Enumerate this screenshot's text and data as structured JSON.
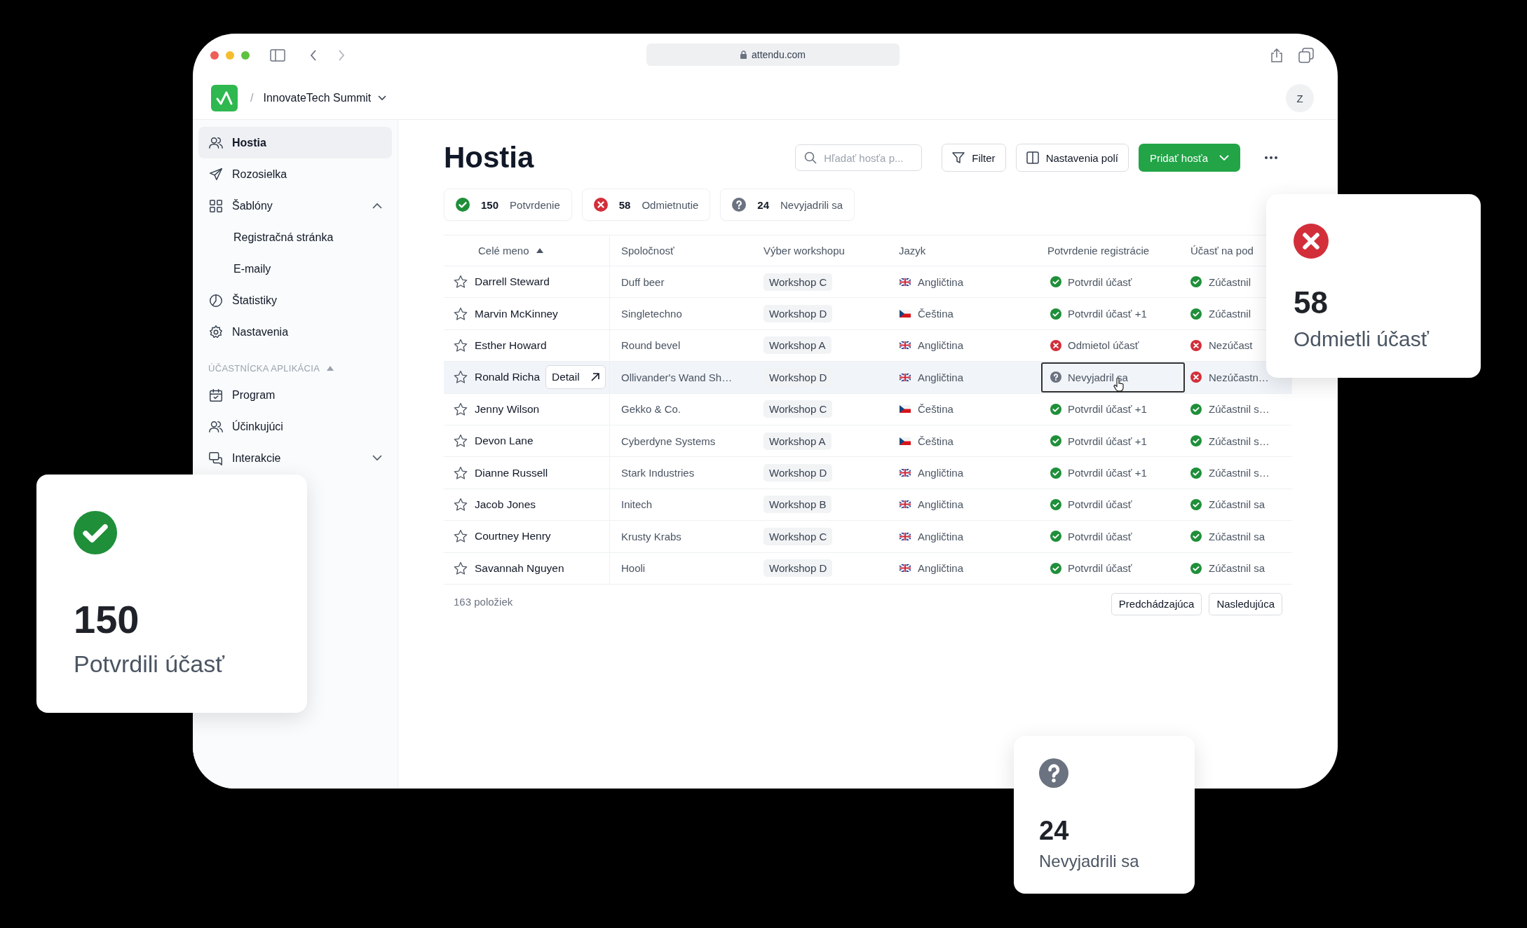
{
  "browser": {
    "url": "attendu.com"
  },
  "header": {
    "breadcrumb": "/",
    "event": "InnovateTech Summit",
    "avatar": "Z"
  },
  "sidebar": {
    "items": [
      {
        "kind": "people",
        "label": "Hostia",
        "selected": true
      },
      {
        "kind": "send",
        "label": "Rozosielka",
        "selected": false
      },
      {
        "kind": "grid",
        "label": "Šablóny",
        "selected": false,
        "expanded": true,
        "children": [
          {
            "label": "Registračná stránka",
            "selected": false
          },
          {
            "label": "E-maily",
            "selected": false
          }
        ]
      },
      {
        "kind": "chart",
        "label": "Štatistiky",
        "selected": false
      },
      {
        "kind": "gear",
        "label": "Nastavenia",
        "selected": false
      }
    ],
    "section": {
      "title": "ÚČASTNÍCKA APLIKÁCIA",
      "expanded": true
    },
    "section_items": [
      {
        "kind": "calendar",
        "label": "Program",
        "selected": false
      },
      {
        "kind": "people",
        "label": "Účinkujúci",
        "selected": false
      },
      {
        "kind": "chat",
        "label": "Interakcie",
        "selected": false,
        "expanded": false
      }
    ]
  },
  "page": {
    "title": "Hostia",
    "search": {
      "placeholder": "Hľadať hosťa p..."
    },
    "buttons": [
      "Filter",
      "Nastavenia polí"
    ],
    "primary_button": "Pridať hosťa"
  },
  "stats": [
    {
      "kind": "confirmed",
      "count": "150",
      "label": "Potvrdenie"
    },
    {
      "kind": "declined",
      "count": "58",
      "label": "Odmietnutie"
    },
    {
      "kind": "unknown",
      "count": "24",
      "label": "Nevyjadrili sa"
    }
  ],
  "table": {
    "columns": [
      {
        "label": "Celé meno",
        "sorted": true
      },
      {
        "label": "Spoločnosť",
        "sorted": false
      },
      {
        "label": "Výber workshopu",
        "sorted": false
      },
      {
        "label": "Jazyk",
        "sorted": false
      },
      {
        "label": "Potvrdenie registrácie",
        "sorted": false
      },
      {
        "label": "Účasť na pod",
        "sorted": false
      }
    ],
    "rows": [
      {
        "starred": false,
        "hovered": false,
        "name": "Darrell Steward",
        "company": "Duff beer",
        "workshop": "Workshop C",
        "language": {
          "kind": "uk",
          "text": "Angličtina"
        },
        "confirmation": {
          "kind": "confirmed",
          "text": "Potvrdil účasť",
          "focused": false
        },
        "attendance": {
          "kind": "confirmed",
          "text": "Zúčastnil"
        }
      },
      {
        "starred": false,
        "hovered": false,
        "name": "Marvin McKinney",
        "company": "Singletechno",
        "workshop": "Workshop D",
        "language": {
          "kind": "cz",
          "text": "Čeština"
        },
        "confirmation": {
          "kind": "confirmed",
          "text": "Potvrdil účasť +1",
          "focused": false
        },
        "attendance": {
          "kind": "confirmed",
          "text": "Zúčastnil"
        }
      },
      {
        "starred": false,
        "hovered": false,
        "name": "Esther Howard",
        "company": "Round bevel",
        "workshop": "Workshop A",
        "language": {
          "kind": "uk",
          "text": "Angličtina"
        },
        "confirmation": {
          "kind": "declined",
          "text": "Odmietol účasť",
          "focused": false
        },
        "attendance": {
          "kind": "declined",
          "text": "Nezúčast"
        }
      },
      {
        "starred": false,
        "hovered": true,
        "name": "Ronald Richa",
        "detail_button": "Detail",
        "company": "Ollivander's Wand Sh…",
        "workshop": "Workshop D",
        "language": {
          "kind": "uk",
          "text": "Angličtina"
        },
        "confirmation": {
          "kind": "unknown",
          "text": "Nevyjadril sa",
          "focused": true
        },
        "attendance": {
          "kind": "declined",
          "text": "Nezúčastn…"
        }
      },
      {
        "starred": false,
        "hovered": false,
        "name": "Jenny Wilson",
        "company": "Gekko & Co.",
        "workshop": "Workshop C",
        "language": {
          "kind": "cz",
          "text": "Čeština"
        },
        "confirmation": {
          "kind": "confirmed",
          "text": "Potvrdil účasť +1",
          "focused": false
        },
        "attendance": {
          "kind": "confirmed",
          "text": "Zúčastnil s…"
        }
      },
      {
        "starred": false,
        "hovered": false,
        "name": "Devon Lane",
        "company": "Cyberdyne Systems",
        "workshop": "Workshop A",
        "language": {
          "kind": "cz",
          "text": "Čeština"
        },
        "confirmation": {
          "kind": "confirmed",
          "text": "Potvrdil účasť +1",
          "focused": false
        },
        "attendance": {
          "kind": "confirmed",
          "text": "Zúčastnil s…"
        }
      },
      {
        "starred": false,
        "hovered": false,
        "name": "Dianne Russell",
        "company": "Stark Industries",
        "workshop": "Workshop D",
        "language": {
          "kind": "uk",
          "text": "Angličtina"
        },
        "confirmation": {
          "kind": "confirmed",
          "text": "Potvrdil účasť +1",
          "focused": false
        },
        "attendance": {
          "kind": "confirmed",
          "text": "Zúčastnil s…"
        }
      },
      {
        "starred": false,
        "hovered": false,
        "name": "Jacob Jones",
        "company": "Initech",
        "workshop": "Workshop B",
        "language": {
          "kind": "uk",
          "text": "Angličtina"
        },
        "confirmation": {
          "kind": "confirmed",
          "text": "Potvrdil účasť",
          "focused": false
        },
        "attendance": {
          "kind": "confirmed",
          "text": "Zúčastnil sa"
        }
      },
      {
        "starred": false,
        "hovered": false,
        "name": "Courtney Henry",
        "company": "Krusty Krabs",
        "workshop": "Workshop C",
        "language": {
          "kind": "uk",
          "text": "Angličtina"
        },
        "confirmation": {
          "kind": "confirmed",
          "text": "Potvrdil účasť",
          "focused": false
        },
        "attendance": {
          "kind": "confirmed",
          "text": "Zúčastnil sa"
        }
      },
      {
        "starred": false,
        "hovered": false,
        "name": "Savannah Nguyen",
        "company": "Hooli",
        "workshop": "Workshop D",
        "language": {
          "kind": "uk",
          "text": "Angličtina"
        },
        "confirmation": {
          "kind": "confirmed",
          "text": "Potvrdil účasť",
          "focused": false
        },
        "attendance": {
          "kind": "confirmed",
          "text": "Zúčastnil sa"
        }
      }
    ],
    "footer": "163 položiek",
    "pagination": [
      "Predchádzajúca",
      "Nasledujúca"
    ]
  },
  "floating_cards": [
    {
      "kind": "confirmed",
      "count": "150",
      "label": "Potvrdili účasť"
    },
    {
      "kind": "declined",
      "count": "58",
      "label": "Odmietli účasť"
    },
    {
      "kind": "unknown",
      "count": "24",
      "label": "Nevyjadrili sa"
    }
  ]
}
